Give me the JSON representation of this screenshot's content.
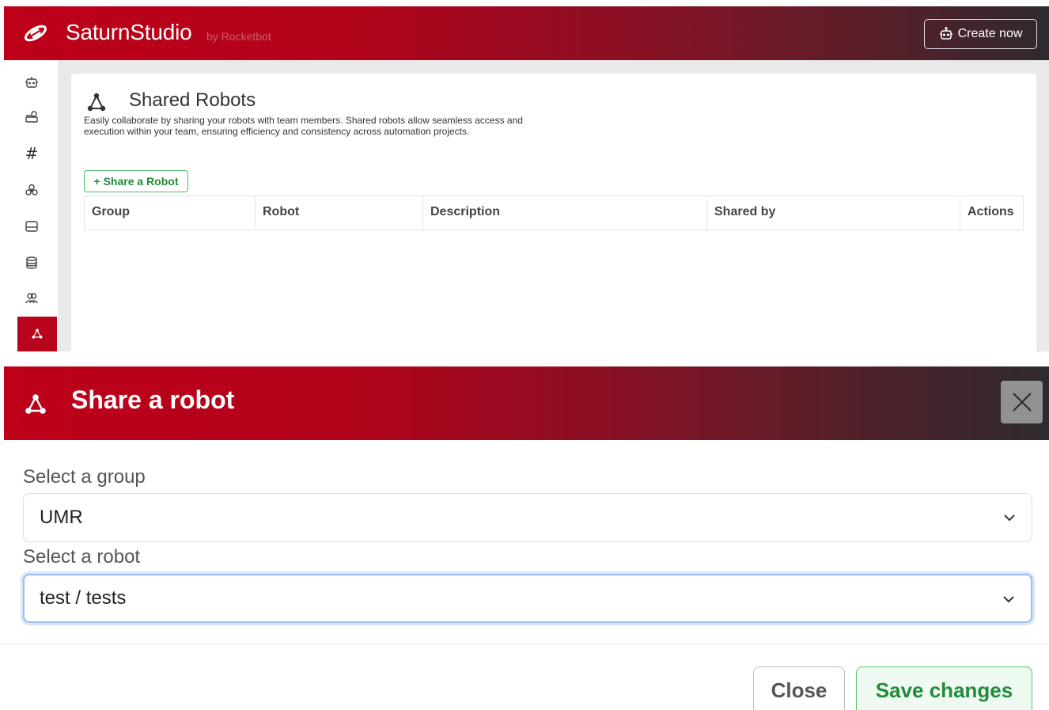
{
  "header": {
    "brand_name": "SaturnStudio",
    "brand_by": "by Rocketbot",
    "create_button_label": "Create now",
    "logo_icon": "saturn-logo-icon",
    "gradient_start": "#be0019",
    "gradient_end": "#2e2a2f"
  },
  "sidebar": {
    "items": [
      {
        "name": "robot",
        "icon": "robot-icon"
      },
      {
        "name": "orchestrator",
        "icon": "server-icon"
      },
      {
        "name": "tags",
        "label": "#",
        "icon": "hash-icon"
      },
      {
        "name": "integrations",
        "icon": "biohazard-icon"
      },
      {
        "name": "forms",
        "icon": "window-icon"
      },
      {
        "name": "databases",
        "icon": "database-icon"
      },
      {
        "name": "users",
        "icon": "users-icon"
      },
      {
        "name": "shared-robots",
        "icon": "share-nodes-icon",
        "active": true
      }
    ],
    "active_color": "#b8041c"
  },
  "page": {
    "title": "Shared Robots",
    "description": "Easily collaborate by sharing your robots with team members. Shared robots allow seamless access and execution within your team, ensuring efficiency and consistency across automation projects.",
    "share_button_label": "+ Share a Robot",
    "table": {
      "columns": [
        "Group",
        "Robot",
        "Description",
        "Shared by",
        "Actions"
      ],
      "rows": []
    }
  },
  "modal": {
    "title": "Share a robot",
    "group_label": "Select a group",
    "group_value": "UMR",
    "robot_label": "Select a robot",
    "robot_value": "test / tests",
    "close_label": "Close",
    "save_label": "Save changes",
    "save_color": "#228a3b"
  }
}
